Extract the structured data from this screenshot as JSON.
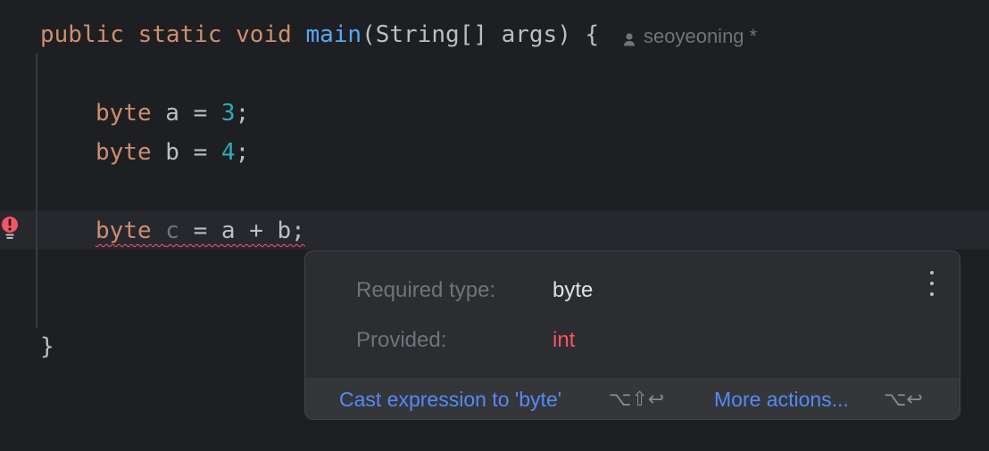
{
  "code": {
    "signature": {
      "public": "public",
      "static": "static",
      "void": "void",
      "method": "main",
      "params": "(String[] args) {"
    },
    "line_a": {
      "type": "byte",
      "rest1": " a = ",
      "value": "3",
      "end": ";"
    },
    "line_b": {
      "type": "byte",
      "rest1": " b = ",
      "value": "4",
      "end": ";"
    },
    "line_c": {
      "type": "byte",
      "var": "c",
      "rest": " = a + b;"
    },
    "closing_brace": "}"
  },
  "author": {
    "name": "seoyeoning *",
    "icon": "person-icon"
  },
  "gutter": {
    "icon": "error-bulb-icon",
    "color": "#f75464"
  },
  "popup": {
    "required_label": "Required type:",
    "required_value": "byte",
    "provided_label": "Provided:",
    "provided_value": "int",
    "menu_icon": "kebab-menu-icon",
    "action_primary": "Cast expression to 'byte'",
    "action_primary_shortcut": "⌥⇧↩",
    "action_more": "More actions...",
    "action_more_shortcut": "⌥↩"
  },
  "colors": {
    "background": "#1e1f22",
    "keyword": "#cf8e6d",
    "method": "#56a8f5",
    "number": "#2aacb8",
    "error": "#f75464",
    "link": "#548af7"
  }
}
